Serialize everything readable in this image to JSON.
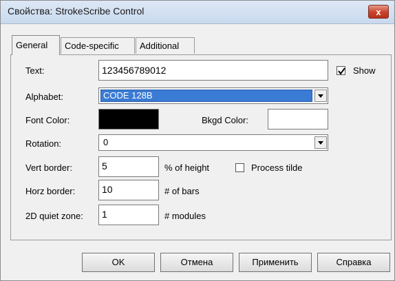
{
  "window": {
    "title": "Свойства: StrokeScribe Control",
    "close_label": "x"
  },
  "tabs": [
    {
      "label": "General",
      "active": true
    },
    {
      "label": "Code-specific",
      "active": false
    },
    {
      "label": "Additional",
      "active": false
    }
  ],
  "general": {
    "text_label": "Text:",
    "text_value": "123456789012",
    "show_label": "Show",
    "show_checked": true,
    "alphabet_label": "Alphabet:",
    "alphabet_value": "CODE 128B",
    "font_color_label": "Font Color:",
    "font_color": "#000000",
    "bkgd_color_label": "Bkgd Color:",
    "bkgd_color": "#ffffff",
    "rotation_label": "Rotation:",
    "rotation_value": "0",
    "vert_border_label": "Vert border:",
    "vert_border_value": "5",
    "vert_border_unit": "% of height",
    "process_tilde_label": "Process tilde",
    "process_tilde_checked": false,
    "horz_border_label": "Horz border:",
    "horz_border_value": "10",
    "horz_border_unit": "# of bars",
    "quiet_zone_label": "2D quiet zone:",
    "quiet_zone_value": "1",
    "quiet_zone_unit": "# modules"
  },
  "buttons": {
    "ok": "OK",
    "cancel": "Отмена",
    "apply": "Применить",
    "help": "Справка"
  },
  "colors": {
    "selection": "#3a7bd5",
    "titlebar": "#c9d9ee",
    "close": "#c7412b"
  }
}
